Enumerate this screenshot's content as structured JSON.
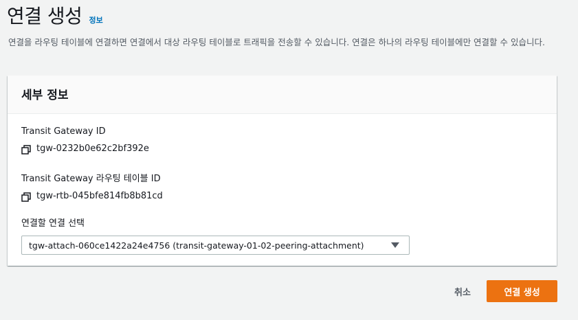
{
  "header": {
    "title": "연결 생성",
    "info_link": "정보"
  },
  "description": "연결을 라우팅 테이블에 연결하면 연결에서 대상 라우팅 테이블로 트래픽을 전송할 수 있습니다. 연결은 하나의 라우팅 테이블에만 연결할 수 있습니다.",
  "panel": {
    "title": "세부 정보",
    "transit_gateway": {
      "label": "Transit Gateway ID",
      "value": "tgw-0232b0e62c2bf392e",
      "icon": "copy-icon"
    },
    "route_table": {
      "label": "Transit Gateway 라우팅 테이블 ID",
      "value": "tgw-rtb-045bfe814fb8b81cd",
      "icon": "copy-icon"
    },
    "attachment": {
      "label": "연결할 연결 선택",
      "selected": "tgw-attach-060ce1422a24e4756 (transit-gateway-01-02-peering-attachment)",
      "icon": "caret-down-icon"
    }
  },
  "actions": {
    "cancel": "취소",
    "create": "연결 생성"
  },
  "colors": {
    "accent": "#ec7211",
    "link": "#0073bb",
    "background": "#f2f3f3"
  }
}
